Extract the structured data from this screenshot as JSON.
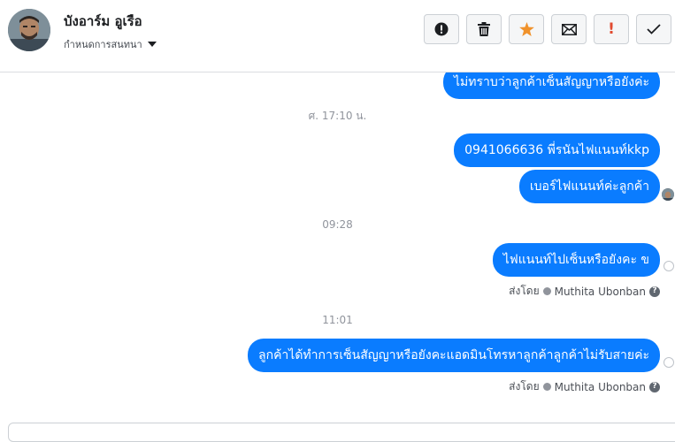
{
  "contact": {
    "name": "บังอาร์ม อูเรือ",
    "subtitle": "กำหนดการสนทนา"
  },
  "toolbar": {
    "buttons": [
      {
        "icon": "alert-circle-icon",
        "label": "Spam"
      },
      {
        "icon": "trash-icon",
        "label": "Delete"
      },
      {
        "icon": "star-icon",
        "label": "Star",
        "color": "#f0922b"
      },
      {
        "icon": "envelope-icon",
        "label": "Mark unread"
      },
      {
        "icon": "exclamation-icon",
        "label": "!",
        "color": "#e14a2f"
      },
      {
        "icon": "check-icon",
        "label": "Done"
      }
    ]
  },
  "messages": {
    "cut_top": "ไม่ทราบว่าลูกค้าเซ็นสัญญาหรือยังค่ะ",
    "ts1": "ศ. 17:10 น.",
    "msg1": "0941066636 พี่รนันไฟแนนท์kkp",
    "msg2": "เบอร์ไฟแนนท์ค่ะลูกค้า",
    "ts2": "09:28",
    "msg3": "ไฟแนนท์ไปเซ็นหรือยังคะ ข",
    "sent_by_label": "ส่งโดย",
    "sender": "Muthita Ubonban",
    "ts3": "11:01",
    "msg4": "ลูกค้าได้ทำการเซ็นสัญญาหรือยังคะแอดมินโทรหาลูกค้าลูกค้าไม่รับสายค่ะ"
  },
  "colors": {
    "bubble": "#0a7cff",
    "star": "#f0922b",
    "alert": "#e14a2f"
  }
}
